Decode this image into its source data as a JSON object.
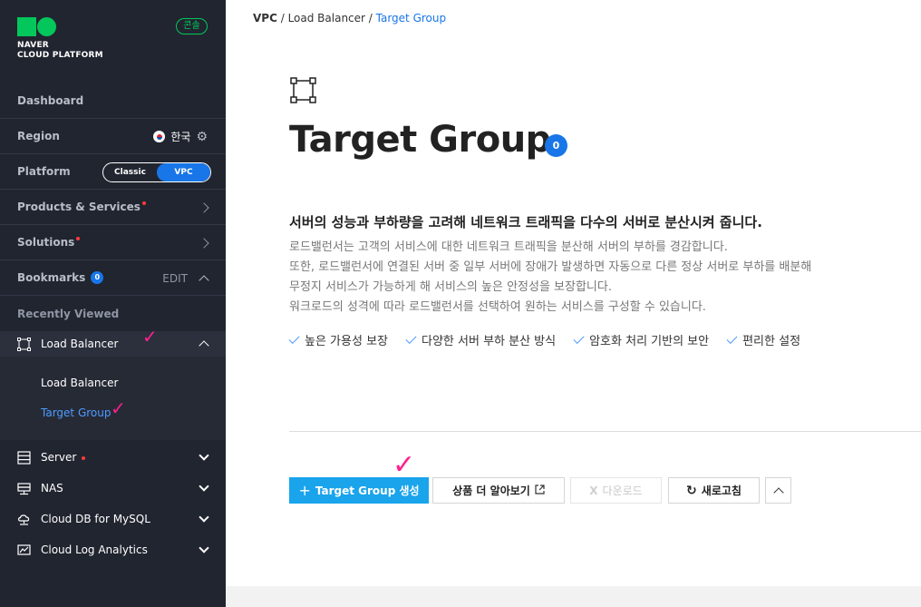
{
  "brand": {
    "line1": "NAVER",
    "line2": "CLOUD PLATFORM",
    "color": "#03c75a"
  },
  "console_label": "콘솔",
  "sidebar": {
    "dashboard": "Dashboard",
    "region": {
      "label": "Region",
      "value": "한국"
    },
    "platform": {
      "label": "Platform",
      "options": [
        "Classic",
        "VPC"
      ],
      "selected": "VPC"
    },
    "products": "Products & Services",
    "solutions": "Solutions",
    "bookmarks": {
      "label": "Bookmarks",
      "count": "0",
      "edit": "EDIT"
    },
    "recently_viewed": "Recently Viewed",
    "recent": [
      {
        "label": "Load Balancer",
        "expanded": true,
        "children": [
          "Load Balancer",
          "Target Group"
        ],
        "active_child": "Target Group"
      },
      {
        "label": "Server",
        "new": true
      },
      {
        "label": "NAS"
      },
      {
        "label": "Cloud DB for MySQL"
      },
      {
        "label": "Cloud Log Analytics"
      }
    ]
  },
  "breadcrumb": [
    "VPC",
    "Load Balancer",
    "Target Group"
  ],
  "page": {
    "title": "Target Group",
    "count": "0",
    "headline": "서버의 성능과 부하량을 고려해 네트워크 트래픽을 다수의 서버로 분산시켜 줍니다.",
    "description": [
      "로드밸런서는 고객의 서비스에 대한 네트워크 트래픽을 분산해 서버의 부하를 경감합니다.",
      "또한, 로드밸런서에 연결된 서버 중 일부 서버에 장애가 발생하면 자동으로 다른 정상 서버로 부하를 배분해",
      "무정지 서비스가 가능하게 해 서비스의 높은 안정성을 보장합니다.",
      "워크로드의 성격에 따라 로드밸런서를 선택하여 원하는 서비스를 구성할 수 있습니다."
    ],
    "features": [
      "높은 가용성 보장",
      "다양한 서버 부하 분산 방식",
      "암호화 처리 기반의 보안",
      "편리한 설정"
    ]
  },
  "actions": {
    "create": "Target Group 생성",
    "learn_more": "상품 더 알아보기",
    "download": "다운로드",
    "refresh": "새로고침"
  },
  "colors": {
    "accent": "#1876e8",
    "primary_button": "#1aa4ec",
    "annotation": "#ff1f8e"
  }
}
